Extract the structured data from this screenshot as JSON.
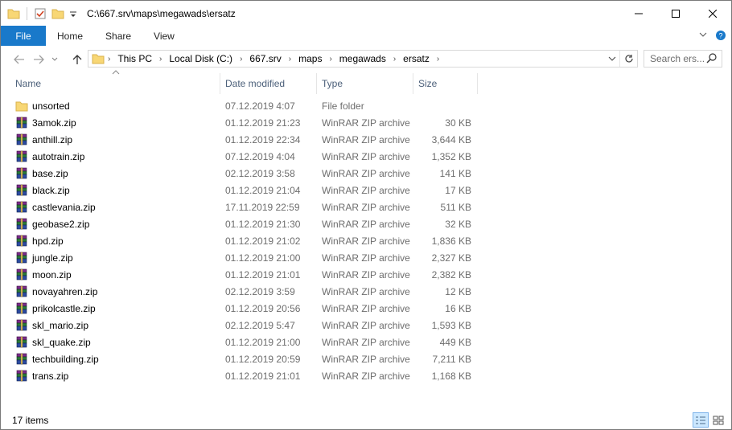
{
  "window": {
    "title_path": "C:\\667.srv\\maps\\megawads\\ersatz",
    "minimize": "—",
    "maximize": "☐",
    "close": "✕"
  },
  "ribbon": {
    "tabs": [
      "File",
      "Home",
      "Share",
      "View"
    ],
    "expand": "⌄",
    "help": "?"
  },
  "address": {
    "crumbs": [
      "This PC",
      "Local Disk (C:)",
      "667.srv",
      "maps",
      "megawads",
      "ersatz"
    ],
    "search_placeholder": "Search ers..."
  },
  "columns": {
    "name": "Name",
    "date": "Date modified",
    "type": "Type",
    "size": "Size"
  },
  "files": [
    {
      "name": "unsorted",
      "date": "07.12.2019 4:07",
      "type": "File folder",
      "size": "",
      "icon": "folder-icon"
    },
    {
      "name": "3amok.zip",
      "date": "01.12.2019 21:23",
      "type": "WinRAR ZIP archive",
      "size": "30 KB",
      "icon": "winrar-archive-icon"
    },
    {
      "name": "anthill.zip",
      "date": "01.12.2019 22:34",
      "type": "WinRAR ZIP archive",
      "size": "3,644 KB",
      "icon": "winrar-archive-icon"
    },
    {
      "name": "autotrain.zip",
      "date": "07.12.2019 4:04",
      "type": "WinRAR ZIP archive",
      "size": "1,352 KB",
      "icon": "winrar-archive-icon"
    },
    {
      "name": "base.zip",
      "date": "02.12.2019 3:58",
      "type": "WinRAR ZIP archive",
      "size": "141 KB",
      "icon": "winrar-archive-icon"
    },
    {
      "name": "black.zip",
      "date": "01.12.2019 21:04",
      "type": "WinRAR ZIP archive",
      "size": "17 KB",
      "icon": "winrar-archive-icon"
    },
    {
      "name": "castlevania.zip",
      "date": "17.11.2019 22:59",
      "type": "WinRAR ZIP archive",
      "size": "511 KB",
      "icon": "winrar-archive-icon"
    },
    {
      "name": "geobase2.zip",
      "date": "01.12.2019 21:30",
      "type": "WinRAR ZIP archive",
      "size": "32 KB",
      "icon": "winrar-archive-icon"
    },
    {
      "name": "hpd.zip",
      "date": "01.12.2019 21:02",
      "type": "WinRAR ZIP archive",
      "size": "1,836 KB",
      "icon": "winrar-archive-icon"
    },
    {
      "name": "jungle.zip",
      "date": "01.12.2019 21:00",
      "type": "WinRAR ZIP archive",
      "size": "2,327 KB",
      "icon": "winrar-archive-icon"
    },
    {
      "name": "moon.zip",
      "date": "01.12.2019 21:01",
      "type": "WinRAR ZIP archive",
      "size": "2,382 KB",
      "icon": "winrar-archive-icon"
    },
    {
      "name": "novayahren.zip",
      "date": "02.12.2019 3:59",
      "type": "WinRAR ZIP archive",
      "size": "12 KB",
      "icon": "winrar-archive-icon"
    },
    {
      "name": "prikolcastle.zip",
      "date": "01.12.2019 20:56",
      "type": "WinRAR ZIP archive",
      "size": "16 KB",
      "icon": "winrar-archive-icon"
    },
    {
      "name": "skl_mario.zip",
      "date": "02.12.2019 5:47",
      "type": "WinRAR ZIP archive",
      "size": "1,593 KB",
      "icon": "winrar-archive-icon"
    },
    {
      "name": "skl_quake.zip",
      "date": "01.12.2019 21:00",
      "type": "WinRAR ZIP archive",
      "size": "449 KB",
      "icon": "winrar-archive-icon"
    },
    {
      "name": "techbuilding.zip",
      "date": "01.12.2019 20:59",
      "type": "WinRAR ZIP archive",
      "size": "7,211 KB",
      "icon": "winrar-archive-icon"
    },
    {
      "name": "trans.zip",
      "date": "01.12.2019 21:01",
      "type": "WinRAR ZIP archive",
      "size": "1,168 KB",
      "icon": "winrar-archive-icon"
    }
  ],
  "status": {
    "item_count": "17 items"
  },
  "colors": {
    "file_tab": "#1979ca",
    "header_text": "#4c607a",
    "folder": "#f8d775",
    "active_view": "#cce8ff"
  }
}
